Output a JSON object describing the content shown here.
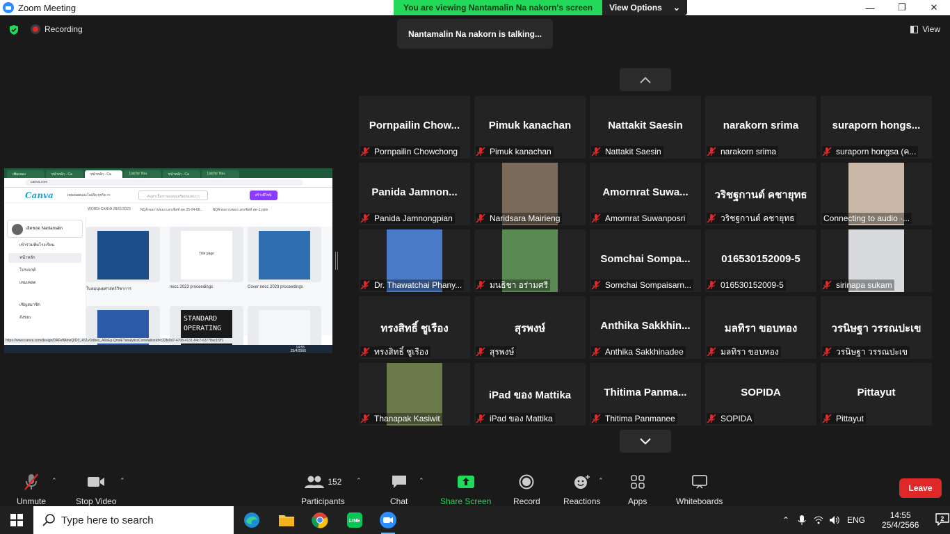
{
  "window": {
    "title": "Zoom Meeting",
    "viewing_banner": "You are viewing Nantamalin Na nakorn's screen",
    "view_options": "View Options",
    "talking": "Nantamalin Na nakorn is talking...",
    "recording": "Recording",
    "view": "View"
  },
  "shared_screen": {
    "tabs": [
      "เพิ่มเพลง",
      "หน้าหลัก - Ca",
      "หน้าหลัก - Ca",
      "List for You",
      "หน้าหลัก - Ca",
      "List for You"
    ],
    "url": "canva.com",
    "logo": "Canva",
    "nav": "เทมเพลตและไอเดีย   ธุรกิจ   •••",
    "search_placeholder": "ค้นหาเนื้อหาของคุณหรือบนแคนวา",
    "cta": "สร้างดีไซน์",
    "profile": "เอิดชลอ Nantamalin",
    "menu": [
      "เข้าร่วมทีมโรงเรียน",
      "หน้าหลัก",
      "โปรเจกต์",
      "เทมเพลต",
      "เชิญสมาชิก",
      "ถังขยะ"
    ],
    "thumbs": [
      {
        "label": "ใบลมนุษยศาสตร์วิชาการ",
        "color": "#1c4d8a"
      },
      {
        "label": "necc 2023 proceedings",
        "color": "#ffffff"
      },
      {
        "label": "Cover necc 2023 proceedings",
        "color": "#2f6fb0"
      }
    ],
    "thumbs_row2": [
      {
        "label": "",
        "color": "#2b5aa8"
      },
      {
        "label": "STANDARD OPERATING",
        "color": "#1a1a1a"
      },
      {
        "label": "",
        "color": "#f4f6f9"
      }
    ],
    "top_labels": [
      "WORD+CANVA 28/01/2023",
      "NQA-ผลงานของ เลกเซิสท์ สุด 25-04-66...",
      "NQA-ผลงานของ เลกเซิสท์ สุด-1.pptx"
    ],
    "thumb_titles": {
      "title_page": "Title page",
      "std": "STANDARD",
      "op": "OPERATING"
    },
    "status_url": "https://www.canva.com/design/DAFeffAtneQ/O3_4S1vOdbvo_A6bEg-QmdE?analyticsCorrelationId=c32fe0d7-4708-4131-84c7-63778ac1f2f1",
    "clock": "14:55",
    "date": "25/4/2566"
  },
  "participants": [
    {
      "big": "Pornpailin  Chow...",
      "name": "Pornpailin Chowchong"
    },
    {
      "big": "Pimuk kanachan",
      "name": "Pimuk kanachan"
    },
    {
      "big": "Nattakit Saesin",
      "name": "Nattakit Saesin"
    },
    {
      "big": "narakorn srima",
      "name": "narakorn srima"
    },
    {
      "big": "suraporn  hongs...",
      "name": "suraporn hongsa (ค..."
    },
    {
      "big": "Panida  Jamnon...",
      "name": "Panida Jamnongpian"
    },
    {
      "big": "",
      "name": "Naridsara Mairieng",
      "photo": "#7a6a5a"
    },
    {
      "big": "Amornrat  Suwa...",
      "name": "Amornrat Suwanposri"
    },
    {
      "big": "วริชฐกานต์ คชายุทธ",
      "name": "วริชฐกานต์ คชายุทธ"
    },
    {
      "big": "",
      "name": "Connecting to audio ·...",
      "photo": "#c9b8a8",
      "nomic": true
    },
    {
      "big": "",
      "name": "Dr. Thawatchai Phany...",
      "photo": "#4a7bc8"
    },
    {
      "big": "",
      "name": "มนธิชา อร่ามศรี",
      "photo": "#5a8a52"
    },
    {
      "big": "Somchai  Sompa...",
      "name": "Somchai Sompaisarn..."
    },
    {
      "big": "016530152009-5",
      "name": "016530152009-5"
    },
    {
      "big": "",
      "name": "sirinapa sukam",
      "photo": "#d8dade"
    },
    {
      "big": "ทรงสิทธิ์ ชูเรือง",
      "name": "ทรงสิทธิ์ ชูเรือง"
    },
    {
      "big": "สุรพงษ์",
      "name": "สุรพงษ์"
    },
    {
      "big": "Anthika  Sakkhin...",
      "name": "Anthika Sakkhinadee"
    },
    {
      "big": "มลทิรา ขอบทอง",
      "name": "มลทิรา ขอบทอง"
    },
    {
      "big": "วรนิษฐา วรรณปะเข",
      "name": "วรนิษฐา วรรณปะเข"
    },
    {
      "big": "",
      "name": "Thanapak Kasiwit",
      "photo": "#6b7a4a"
    },
    {
      "big": "iPad ของ Mattika",
      "name": "iPad ของ Mattika"
    },
    {
      "big": "Thitima  Panma...",
      "name": "Thitima  Panmanee"
    },
    {
      "big": "SOPIDA",
      "name": "SOPIDA"
    },
    {
      "big": "Pittayut",
      "name": "Pittayut"
    }
  ],
  "toolbar": {
    "unmute": "Unmute",
    "stop_video": "Stop Video",
    "participants_count": "152",
    "participants": "Participants",
    "chat": "Chat",
    "share_screen": "Share Screen",
    "record": "Record",
    "reactions": "Reactions",
    "apps": "Apps",
    "whiteboards": "Whiteboards",
    "leave": "Leave"
  },
  "taskbar": {
    "search_placeholder": "Type here to search",
    "lang": "ENG",
    "time": "14:55",
    "date": "25/4/2566",
    "notifications": "2"
  },
  "colors": {
    "accent_green": "#23d959",
    "leave_red": "#e02828",
    "muted_red": "#e02828"
  }
}
